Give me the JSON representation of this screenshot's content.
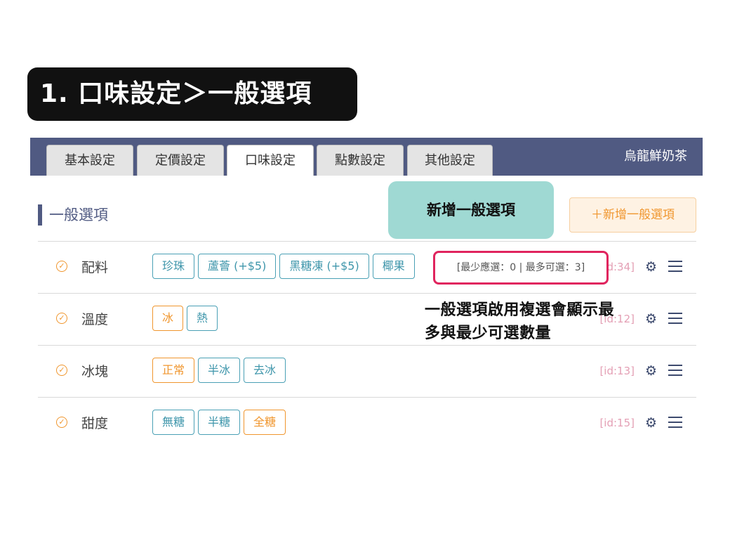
{
  "step_title": "1. 口味設定＞一般選項",
  "tabs": [
    {
      "label": "基本設定",
      "active": false
    },
    {
      "label": "定價設定",
      "active": false
    },
    {
      "label": "口味設定",
      "active": true
    },
    {
      "label": "點數設定",
      "active": false
    },
    {
      "label": "其他設定",
      "active": false
    }
  ],
  "product_name": "烏龍鮮奶茶",
  "section_title": "一般選項",
  "callout_add": "新增一般選項",
  "add_button_label": "＋新增一般選項",
  "rows": [
    {
      "name": "配料",
      "options": [
        {
          "label": "珍珠",
          "selected": false
        },
        {
          "label": "蘆薈 (+$5)",
          "selected": false
        },
        {
          "label": "黑糖凍 (+$5)",
          "selected": false
        },
        {
          "label": "椰果",
          "selected": false
        }
      ],
      "id_label": "[id:34]",
      "constraint": "[最少應選：0 | 最多可選：3]"
    },
    {
      "name": "溫度",
      "options": [
        {
          "label": "冰",
          "selected": true
        },
        {
          "label": "熱",
          "selected": false
        }
      ],
      "id_label": "[id:12]"
    },
    {
      "name": "冰塊",
      "options": [
        {
          "label": "正常",
          "selected": true
        },
        {
          "label": "半冰",
          "selected": false
        },
        {
          "label": "去冰",
          "selected": false
        }
      ],
      "id_label": "[id:13]"
    },
    {
      "name": "甜度",
      "options": [
        {
          "label": "無糖",
          "selected": false
        },
        {
          "label": "半糖",
          "selected": false
        },
        {
          "label": "全糖",
          "selected": true
        }
      ],
      "id_label": "[id:15]"
    }
  ],
  "annotation_note": "一般選項啟用複選會顯示最多與最少可選數量",
  "colors": {
    "header_bg": "#505a82",
    "accent_orange": "#f0962e",
    "chip_teal": "#4aa0b5",
    "highlight_red": "#e0245e",
    "callout_teal": "#9fd9d3"
  },
  "icons": {
    "check": "check-circle-icon",
    "gear": "gear-icon",
    "menu": "hamburger-icon"
  }
}
